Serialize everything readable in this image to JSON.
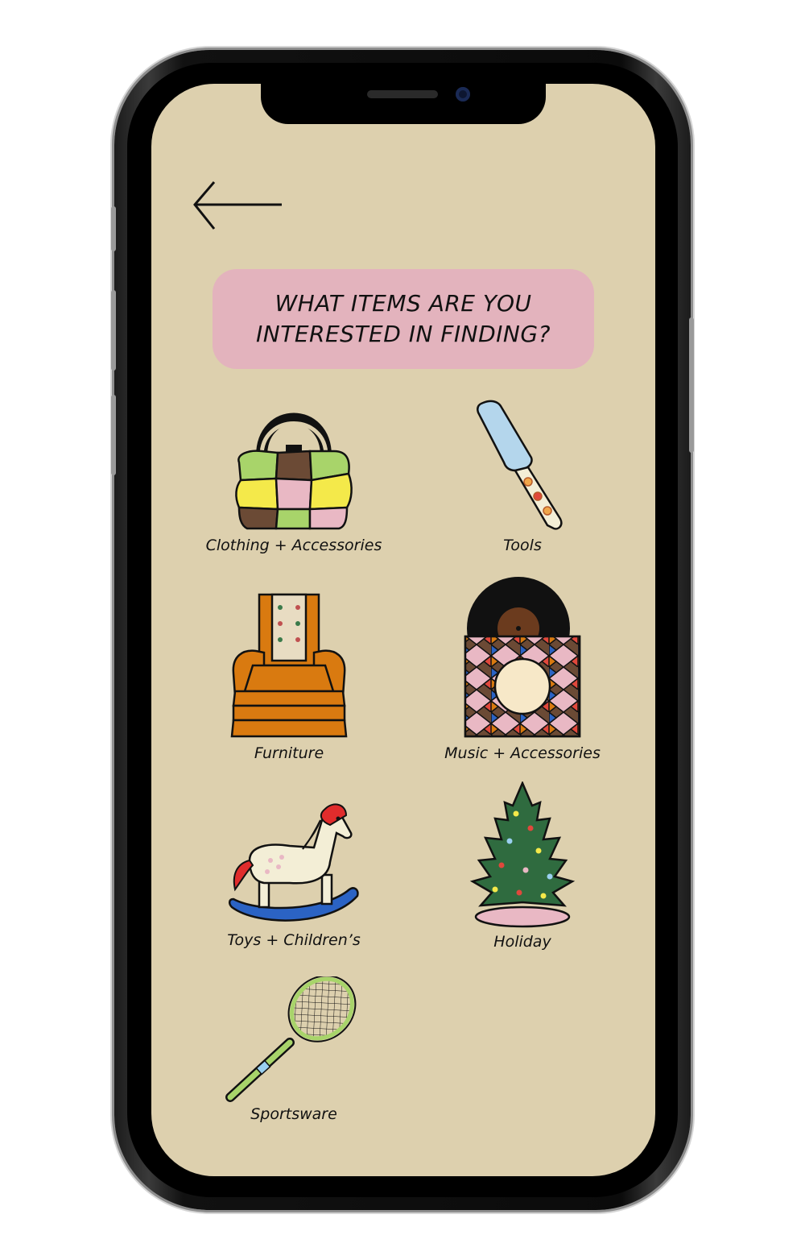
{
  "screen": {
    "background": "#ddd0ae",
    "back_button_icon": "left-arrow-icon",
    "question": "WHAT ITEMS ARE YOU\nINTERESTED IN FINDING?",
    "question_bg": "#e3b3bd"
  },
  "categories": [
    {
      "label": "Clothing + Accessories",
      "icon": "patchwork-handbag-icon"
    },
    {
      "label": "Tools",
      "icon": "garden-trowel-icon"
    },
    {
      "label": "Furniture",
      "icon": "armchair-icon"
    },
    {
      "label": "Music + Accessories",
      "icon": "vinyl-record-icon"
    },
    {
      "label": "Toys + Children’s",
      "icon": "rocking-horse-icon"
    },
    {
      "label": "Holiday",
      "icon": "christmas-tree-icon"
    },
    {
      "label": "Sportsware",
      "icon": "tennis-racket-icon"
    }
  ]
}
